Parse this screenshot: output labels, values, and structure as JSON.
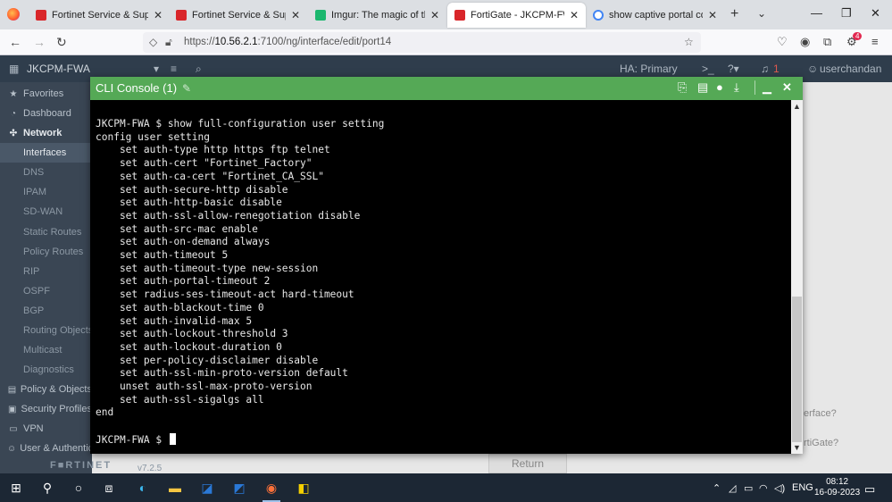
{
  "browser": {
    "tabs": [
      {
        "title": "Fortinet Service & Support",
        "favicon": "fortinet-icon",
        "active": false
      },
      {
        "title": "Fortinet Service & Support",
        "favicon": "fortinet-icon",
        "active": false
      },
      {
        "title": "Imgur: The magic of the Inter",
        "favicon": "imgur-icon",
        "active": false
      },
      {
        "title": "FortiGate - JKCPM-FWA",
        "favicon": "fortinet-icon",
        "active": true
      },
      {
        "title": "show captive portal config in",
        "favicon": "google-icon",
        "active": false
      }
    ],
    "url_prefix": "https://",
    "url_host": "10.56.2.1",
    "url_rest": ":7100/ng/interface/edit/port14",
    "extension_badge": "4"
  },
  "app": {
    "hostname": "JKCPM-FWA",
    "ha_status": "HA: Primary",
    "notification_count": "1",
    "user": "userchandan",
    "brand": "F■RTINET",
    "version": "v7.2.5",
    "return_label": "Return",
    "peek_text_1": "erface?",
    "peek_text_2": "rtiGate?",
    "sidebar": [
      {
        "label": "Favorites",
        "icon": "star-icon",
        "type": "top"
      },
      {
        "label": "Dashboard",
        "icon": "dashboard-icon",
        "type": "top"
      },
      {
        "label": "Network",
        "icon": "network-icon",
        "type": "section"
      },
      {
        "label": "Interfaces",
        "icon": "",
        "type": "active"
      },
      {
        "label": "DNS",
        "icon": "",
        "type": "sub"
      },
      {
        "label": "IPAM",
        "icon": "",
        "type": "sub"
      },
      {
        "label": "SD-WAN",
        "icon": "",
        "type": "sub"
      },
      {
        "label": "Static Routes",
        "icon": "",
        "type": "sub"
      },
      {
        "label": "Policy Routes",
        "icon": "",
        "type": "sub"
      },
      {
        "label": "RIP",
        "icon": "",
        "type": "sub"
      },
      {
        "label": "OSPF",
        "icon": "",
        "type": "sub"
      },
      {
        "label": "BGP",
        "icon": "",
        "type": "sub"
      },
      {
        "label": "Routing Objects",
        "icon": "",
        "type": "sub"
      },
      {
        "label": "Multicast",
        "icon": "",
        "type": "sub"
      },
      {
        "label": "Diagnostics",
        "icon": "",
        "type": "sub"
      },
      {
        "label": "Policy & Objects",
        "icon": "policy-icon",
        "type": "top"
      },
      {
        "label": "Security Profiles",
        "icon": "lock-icon",
        "type": "top"
      },
      {
        "label": "VPN",
        "icon": "vpn-icon",
        "type": "top"
      },
      {
        "label": "User & Authentication",
        "icon": "user-icon",
        "type": "top"
      }
    ]
  },
  "cli": {
    "title": "CLI Console (1)",
    "prompt_line": "JKCPM-FWA $ show full-configuration user setting",
    "lines": [
      "config user setting",
      "    set auth-type http https ftp telnet",
      "    set auth-cert \"Fortinet_Factory\"",
      "    set auth-ca-cert \"Fortinet_CA_SSL\"",
      "    set auth-secure-http disable",
      "    set auth-http-basic disable",
      "    set auth-ssl-allow-renegotiation disable",
      "    set auth-src-mac enable",
      "    set auth-on-demand always",
      "    set auth-timeout 5",
      "    set auth-timeout-type new-session",
      "    set auth-portal-timeout 2",
      "    set radius-ses-timeout-act hard-timeout",
      "    set auth-blackout-time 0",
      "    set auth-invalid-max 5",
      "    set auth-lockout-threshold 3",
      "    set auth-lockout-duration 0",
      "    set per-policy-disclaimer disable",
      "    set auth-ssl-min-proto-version default",
      "    unset auth-ssl-max-proto-version",
      "    set auth-ssl-sigalgs all",
      "end"
    ],
    "final_prompt": "JKCPM-FWA $ "
  },
  "taskbar": {
    "lang": "ENG",
    "time": "08:12",
    "date": "16-09-2023"
  }
}
